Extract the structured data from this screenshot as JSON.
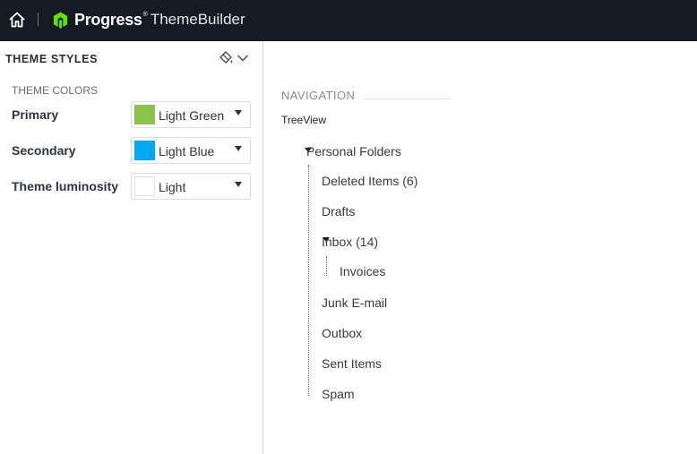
{
  "header": {
    "brand_name": "Progress",
    "brand_tm": "®",
    "product_name": "ThemeBuilder"
  },
  "left_panel": {
    "title": "THEME STYLES",
    "section_label": "THEME COLORS",
    "rows": [
      {
        "label": "Primary",
        "value": "Light Green",
        "swatch_color": "#8bc34a"
      },
      {
        "label": "Secondary",
        "value": "Light Blue",
        "swatch_color": "#03a9f4"
      },
      {
        "label": "Theme luminosity",
        "value": "Light",
        "swatch_color": "#ffffff"
      }
    ]
  },
  "navigation": {
    "section_title": "NAVIGATION",
    "widget_label": "TreeView",
    "tree": {
      "root": "Personal Folders",
      "items": [
        "Deleted Items (6)",
        "Drafts",
        "Inbox (14)",
        "Invoices",
        "Junk E-mail",
        "Outbox",
        "Sent Items",
        "Spam"
      ]
    }
  },
  "colors": {
    "topbar_bg": "#141b23",
    "brand_accent": "#5ce500"
  }
}
